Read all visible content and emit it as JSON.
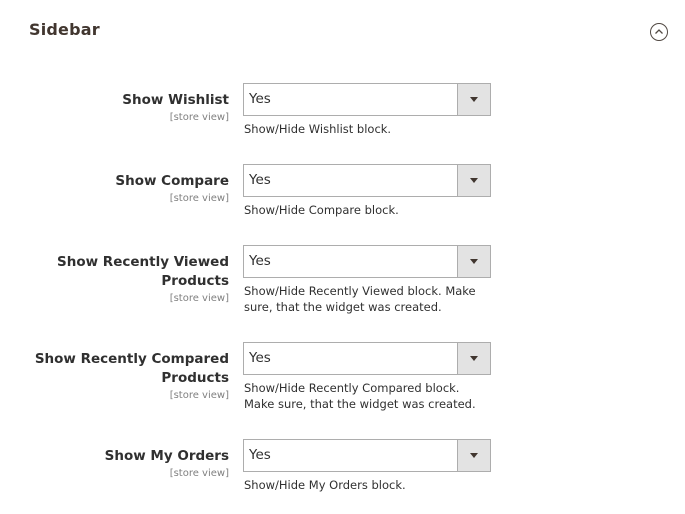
{
  "section": {
    "title": "Sidebar",
    "collapse_icon": "chevron-up-circle-icon"
  },
  "fields": [
    {
      "label_lines": [
        "Show Wishlist"
      ],
      "scope": "[store view]",
      "value": "Yes",
      "note": "Show/Hide Wishlist block."
    },
    {
      "label_lines": [
        "Show Compare"
      ],
      "scope": "[store view]",
      "value": "Yes",
      "note": "Show/Hide Compare block."
    },
    {
      "label_lines": [
        "Show Recently Viewed",
        "Products"
      ],
      "scope": "[store view]",
      "value": "Yes",
      "note": "Show/Hide Recently Viewed block. Make sure, that the widget was created."
    },
    {
      "label_lines": [
        "Show Recently Compared",
        "Products"
      ],
      "scope": "[store view]",
      "value": "Yes",
      "note": "Show/Hide Recently Compared block. Make sure, that the widget was created."
    },
    {
      "label_lines": [
        "Show My Orders"
      ],
      "scope": "[store view]",
      "value": "Yes",
      "note": "Show/Hide My Orders block."
    }
  ]
}
